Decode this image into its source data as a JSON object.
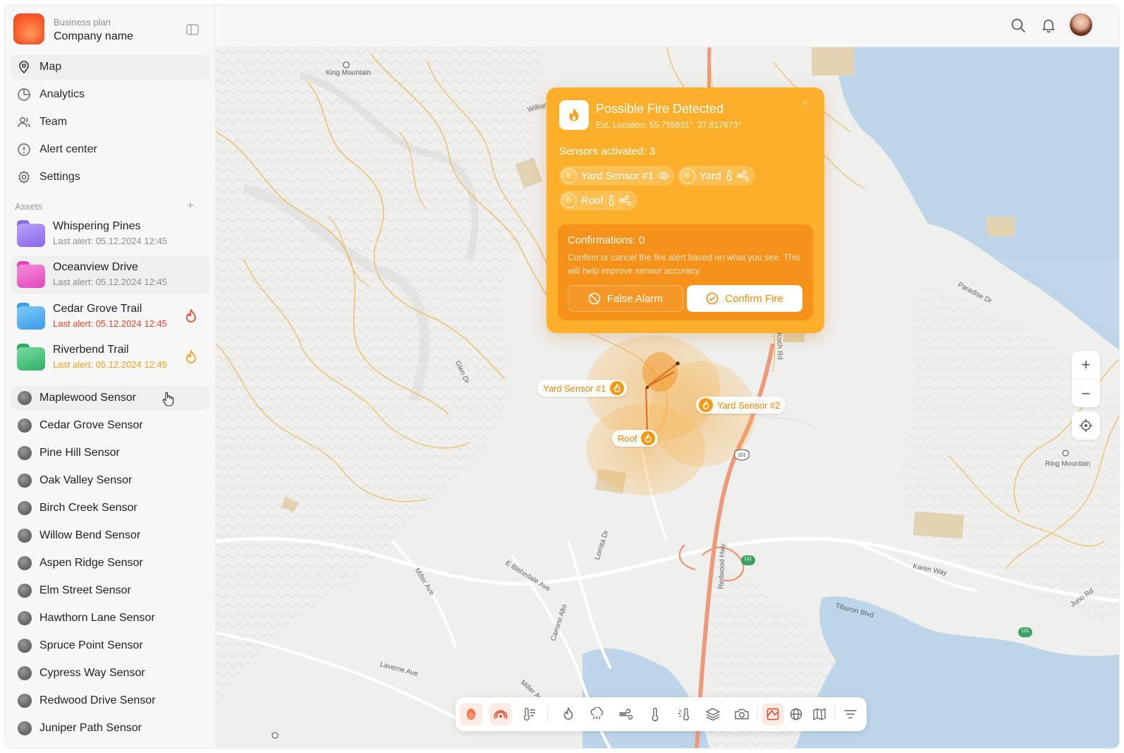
{
  "brand": {
    "plan": "Business plan",
    "company": "Company name"
  },
  "nav": [
    {
      "label": "Map",
      "icon": "map-pin-icon",
      "active": true
    },
    {
      "label": "Analytics",
      "icon": "analytics-icon"
    },
    {
      "label": "Team",
      "icon": "team-icon"
    },
    {
      "label": "Alert center",
      "icon": "alert-icon"
    },
    {
      "label": "Settings",
      "icon": "gear-icon"
    }
  ],
  "assets": {
    "heading": "Assets",
    "items": [
      {
        "name": "Whispering Pines",
        "last_alert": "Last alert: 05.12.2024 12:45",
        "color": "#9b7cf0"
      },
      {
        "name": "Oceanview Drive",
        "last_alert": "Last alert: 05.12.2024 12:45",
        "color": "#ec5fc8"
      },
      {
        "name": "Cedar Grove Trail",
        "last_alert": "Last alert: 05.12.2024 12:45",
        "color": "#48aef2",
        "status": "red"
      },
      {
        "name": "Riverbend Trail",
        "last_alert": "Last alert: 05.12.2024 12:45",
        "color": "#3fc47a",
        "status": "yellow"
      }
    ]
  },
  "sensors": [
    "Maplewood Sensor",
    "Cedar Grove Sensor",
    "Pine Hill Sensor",
    "Oak Valley Sensor",
    "Birch Creek Sensor",
    "Willow Bend Sensor",
    "Aspen Ridge Sensor",
    "Elm Street Sensor",
    "Hawthorn Lane Sensor",
    "Spruce Point Sensor",
    "Cypress Way Sensor",
    "Redwood Drive Sensor",
    "Juniper Path Sensor"
  ],
  "map_labels": {
    "king_mountain": "King Mountain",
    "ring_mountain": "Ring Mountain",
    "glen_dr": "Glen Dr",
    "paradise_dr": "Paradise Dr",
    "e_blithedale": "E Blithedale Ave",
    "miller_ave": "Miller Ave",
    "miller_ave2": "Miller Ave",
    "camino_alto": "Camino Alto",
    "lomita_dr": "Lomita Dr",
    "redwood_hwy": "Redwood Hwy",
    "karen_way": "Karen Way",
    "tiburon_blvd": "Tiburon Blvd",
    "juno_rd": "Juno Rd",
    "laverne_ave": "Laverne Ave",
    "william": "Willian",
    "koch_rd": "Koch Rd",
    "shield_101": "101",
    "shield_131a": "131",
    "shield_131b": "131"
  },
  "pins": {
    "yard1": "Yard Sensor #1",
    "yard2": "Yard Sensor #2",
    "roof": "Roof"
  },
  "popup": {
    "title": "Possible Fire Detected",
    "location": "Est. Location: 55,755831°, 37,617673°",
    "close": "×",
    "sensors_activated": "Sensors activated: 3",
    "chips": [
      "Yard Sensor #1",
      "Yard",
      "Roof"
    ],
    "confirmations": {
      "title": "Confirmations: 0",
      "desc": "Confirm or cancel the fire alert based on what you see. This will help improve sensor accuracy.",
      "false_alarm": "False Alarm",
      "confirm_fire": "Confirm Fire"
    }
  },
  "map_controls": {
    "zoom_in": "+",
    "zoom_out": "−"
  },
  "colors": {
    "accent": "#fbaf2a",
    "accent_dark": "#f6921a",
    "alert_red": "#e8442b",
    "alert_yellow": "#f2a216",
    "highway": "#ee9a7a",
    "road": "#e6b65a"
  }
}
